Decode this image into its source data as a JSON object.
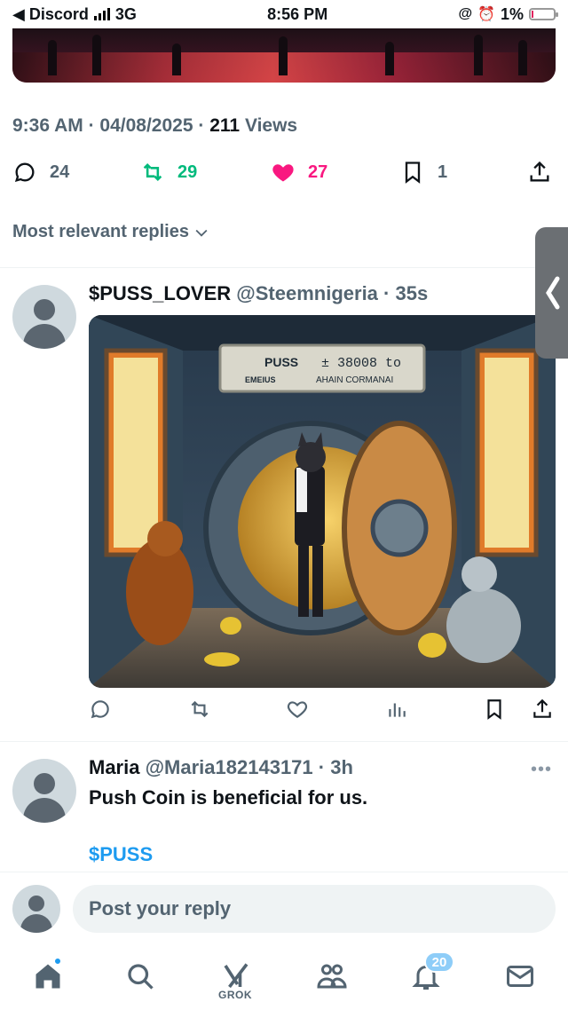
{
  "status_bar": {
    "back_app": "◀ Discord",
    "network": "3G",
    "time": "8:56 PM",
    "battery": "1%"
  },
  "tweet_meta": {
    "time": "9:36 AM",
    "date": "04/08/2025",
    "views_count": "211",
    "views_label": "Views"
  },
  "tweet_actions": {
    "replies": "24",
    "retweets": "29",
    "likes": "27",
    "bookmarks": "1"
  },
  "replies_sort": {
    "label": "Most relevant replies"
  },
  "replies": [
    {
      "name": "$PUSS_LOVER",
      "handle": "@Steemnigeria",
      "time": "35s",
      "image_sign_left": "PUSS",
      "image_sign_left_sub": "EMEIUS",
      "image_sign_right": "± 38008 to",
      "image_sign_right_sub": "AHAIN CORMANAI"
    },
    {
      "name": "Maria",
      "handle": "@Maria182143171",
      "time": "3h",
      "text": "Push Coin is beneficial for us.",
      "cashtag": "$PUSS"
    }
  ],
  "composer": {
    "placeholder": "Post your reply"
  },
  "bottom_nav": {
    "grok_label": "GROK",
    "notifications_badge": "20"
  },
  "colors": {
    "retweet_green": "#00ba7c",
    "like_pink": "#f91880",
    "link_blue": "#1d9bf0",
    "muted": "#536471"
  }
}
